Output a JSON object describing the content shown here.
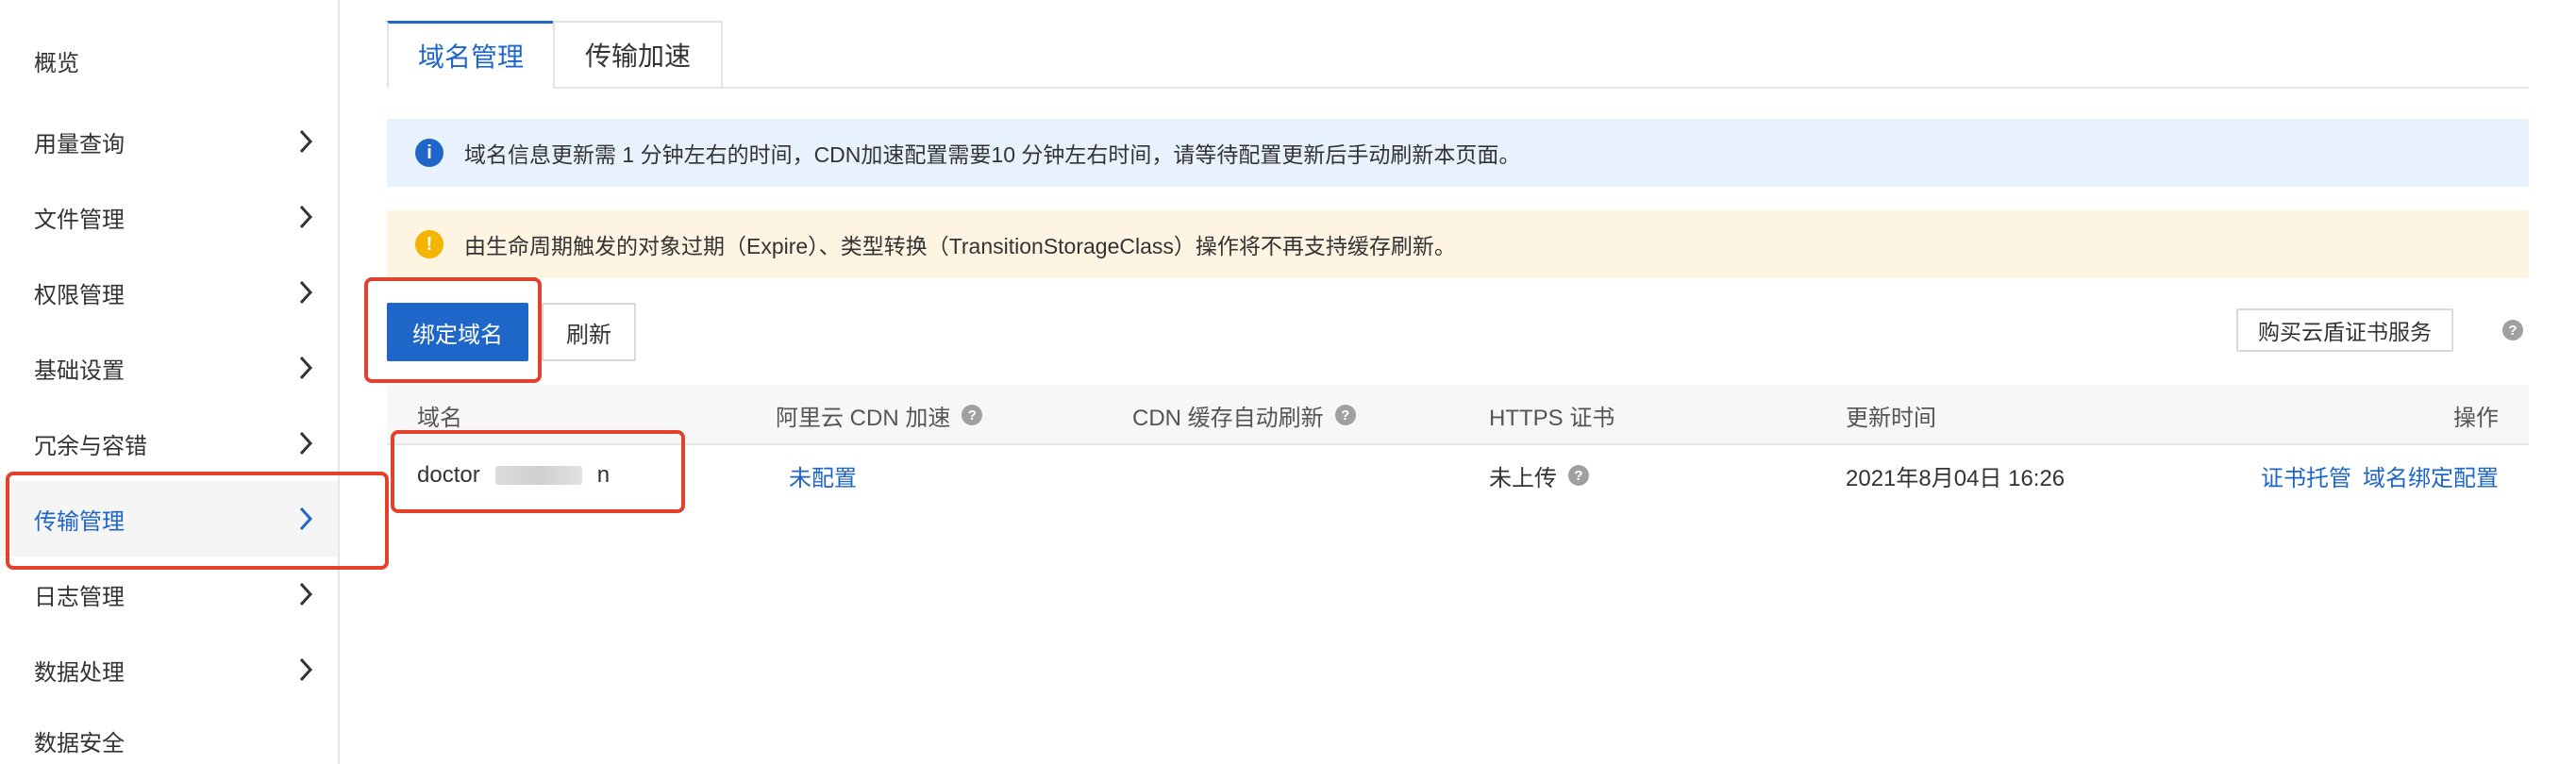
{
  "sidebar": {
    "items": [
      {
        "label": "概览",
        "chevron": false,
        "active": false
      },
      {
        "label": "用量查询",
        "chevron": true,
        "active": false
      },
      {
        "label": "文件管理",
        "chevron": true,
        "active": false
      },
      {
        "label": "权限管理",
        "chevron": true,
        "active": false
      },
      {
        "label": "基础设置",
        "chevron": true,
        "active": false
      },
      {
        "label": "冗余与容错",
        "chevron": true,
        "active": false
      },
      {
        "label": "传输管理",
        "chevron": true,
        "active": true
      },
      {
        "label": "日志管理",
        "chevron": true,
        "active": false
      },
      {
        "label": "数据处理",
        "chevron": true,
        "active": false
      },
      {
        "label": "数据安全",
        "chevron": false,
        "active": false
      }
    ]
  },
  "tabs": [
    {
      "label": "域名管理",
      "active": true
    },
    {
      "label": "传输加速",
      "active": false
    }
  ],
  "alerts": {
    "info": {
      "icon": "info-icon",
      "text": "域名信息更新需 1 分钟左右的时间，CDN加速配置需要10 分钟左右时间，请等待配置更新后手动刷新本页面。"
    },
    "warn": {
      "icon": "warning-icon",
      "text": "由生命周期触发的对象过期（Expire）、类型转换（TransitionStorageClass）操作将不再支持缓存刷新。"
    }
  },
  "toolbar": {
    "bind_domain": "绑定域名",
    "refresh": "刷新",
    "buy_cert": "购买云盾证书服务",
    "help": "?"
  },
  "table": {
    "headers": {
      "domain": "域名",
      "cdn": "阿里云 CDN 加速",
      "cdn_refresh": "CDN 缓存自动刷新",
      "https": "HTTPS 证书",
      "updated": "更新时间",
      "actions": "操作"
    },
    "rows": [
      {
        "domain_prefix": "doctor",
        "domain_suffix": "n",
        "cdn": "未配置",
        "cdn_refresh": "",
        "https": "未上传",
        "updated": "2021年8月04日 16:26",
        "action1": "证书托管",
        "action2": "域名绑定配置"
      }
    ]
  },
  "colors": {
    "accent": "#1e66c8",
    "highlight": "#e2412d",
    "info_bg": "#e8f2fd",
    "warn_bg": "#fdf5e1"
  }
}
